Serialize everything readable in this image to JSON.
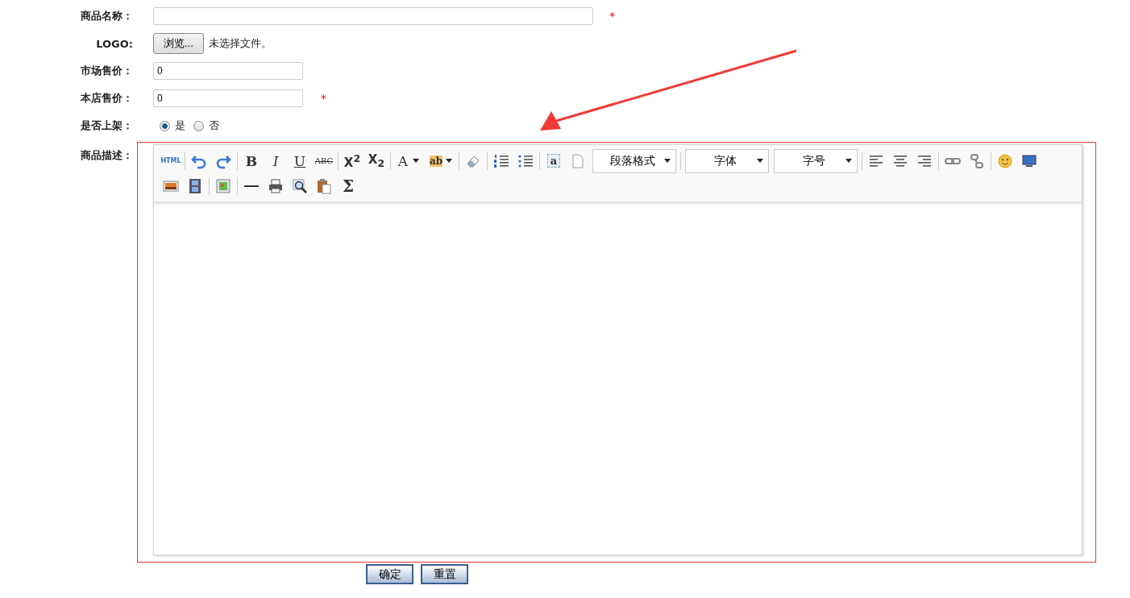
{
  "form": {
    "fields": [
      {
        "kind": "text",
        "label": "商品名称：",
        "required": true,
        "wide": true
      },
      {
        "kind": "file",
        "label": "LOGO:",
        "button": "浏览...",
        "status": "未选择文件。",
        "required": false
      },
      {
        "kind": "text",
        "label": "市场售价：",
        "value": "0",
        "required": false,
        "wide": false
      },
      {
        "kind": "text",
        "label": "本店售价：",
        "value": "0",
        "required": true,
        "wide": false
      },
      {
        "kind": "radio",
        "label": "是否上架：",
        "options": [
          {
            "label": "是",
            "selected": true
          },
          {
            "label": "否",
            "selected": false
          }
        ]
      }
    ],
    "required_mark": "*",
    "editor": {
      "label": "商品描述：",
      "highlighted": true,
      "toolbar": [
        [
          {
            "kind": "html",
            "label": "HTML"
          },
          {
            "kind": "separator"
          },
          {
            "kind": "undo"
          },
          {
            "kind": "redo"
          },
          {
            "kind": "separator"
          },
          {
            "kind": "bold",
            "label": "B"
          },
          {
            "kind": "italic",
            "label": "I"
          },
          {
            "kind": "underline",
            "label": "U"
          },
          {
            "kind": "strike",
            "label": "ABC"
          },
          {
            "kind": "separator"
          },
          {
            "kind": "script",
            "label": "X$^{2}$"
          },
          {
            "kind": "script",
            "label": "X$_{2}$"
          },
          {
            "kind": "separator"
          },
          {
            "kind": "fontcolor",
            "label": "A"
          },
          {
            "kind": "highlight",
            "label": "ab"
          },
          {
            "kind": "separator"
          },
          {
            "kind": "eraser"
          },
          {
            "kind": "separator"
          },
          {
            "kind": "orderedlist"
          },
          {
            "kind": "bulletlist"
          },
          {
            "kind": "separator"
          },
          {
            "kind": "anchor",
            "label": "a"
          },
          {
            "kind": "page"
          },
          {
            "kind": "dropdown",
            "label": "段落格式"
          },
          {
            "kind": "separator"
          },
          {
            "kind": "dropdown",
            "label": "字体"
          },
          {
            "kind": "dropdown",
            "label": "字号"
          },
          {
            "kind": "separator"
          },
          {
            "kind": "alignleft"
          },
          {
            "kind": "aligncenter"
          },
          {
            "kind": "alignright"
          },
          {
            "kind": "separator"
          },
          {
            "kind": "link"
          },
          {
            "kind": "unlink"
          },
          {
            "kind": "separator"
          },
          {
            "kind": "emoticon"
          },
          {
            "kind": "monitor"
          }
        ],
        [
          {
            "kind": "image"
          },
          {
            "kind": "film"
          },
          {
            "kind": "separator"
          },
          {
            "kind": "picture"
          },
          {
            "kind": "separator"
          },
          {
            "kind": "rule"
          },
          {
            "kind": "print"
          },
          {
            "kind": "preview"
          },
          {
            "kind": "paste"
          },
          {
            "kind": "sigma",
            "label": "Σ"
          }
        ]
      ]
    },
    "buttons": [
      "确定",
      "重置"
    ]
  },
  "annotation": {
    "arrow": true
  }
}
